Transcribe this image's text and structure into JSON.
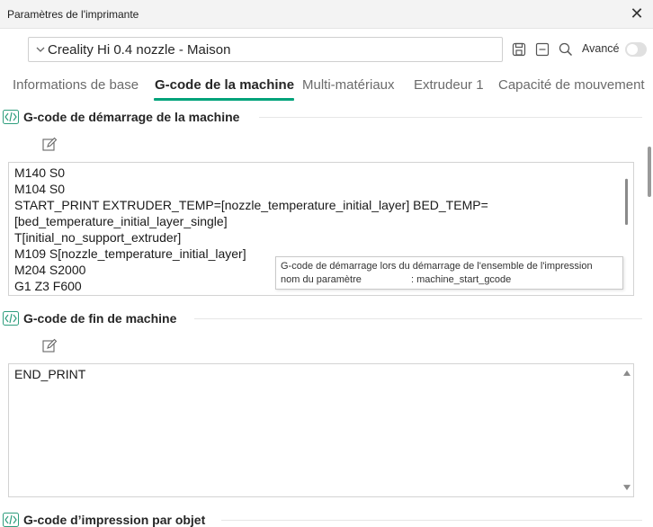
{
  "window": {
    "title": "Paramètres de l'imprimante",
    "close_glyph": "✕"
  },
  "toolbar": {
    "preset_value": "Creality Hi 0.4 nozzle - Maison",
    "advanced_label": "Avancé",
    "advanced_on": false,
    "icons": [
      "save-icon",
      "minus-box-icon",
      "search-icon"
    ]
  },
  "tabs": [
    {
      "label": "Informations de base",
      "active": false
    },
    {
      "label": "G-code de la machine",
      "active": true
    },
    {
      "label": "Multi-matériaux",
      "active": false
    },
    {
      "label": "Extrudeur 1",
      "active": false
    },
    {
      "label": "Capacité de mouvement",
      "active": false
    }
  ],
  "sections": {
    "start": {
      "title": "G-code de démarrage de la machine",
      "lines": [
        "M140 S0",
        "M104 S0",
        "START_PRINT EXTRUDER_TEMP=[nozzle_temperature_initial_layer] BED_TEMP=",
        "[bed_temperature_initial_layer_single]",
        "T[initial_no_support_extruder]",
        "M109 S[nozzle_temperature_initial_layer]",
        "M204 S2000",
        "G1 Z3 F600"
      ]
    },
    "end": {
      "title": "G-code de fin de machine",
      "lines": [
        "END_PRINT"
      ]
    },
    "per_object": {
      "title": "G-code d’impression par objet"
    }
  },
  "tooltip": {
    "line1": "G-code de démarrage lors du démarrage de l'ensemble de l'impression",
    "line2_label": "nom du paramètre",
    "line2_value": ": machine_start_gcode"
  },
  "colors": {
    "accent": "#00a27a",
    "icon": "#2f9e7e"
  }
}
